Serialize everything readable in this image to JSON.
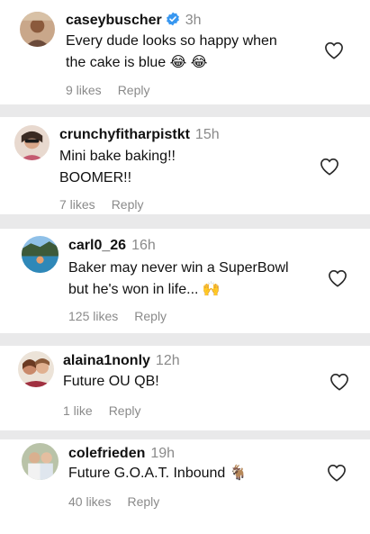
{
  "comments": [
    {
      "username": "caseybuscher",
      "time": "3h",
      "verified": true,
      "text_lines": [
        "Every dude looks so happy when",
        "the cake is blue 😂 😂"
      ],
      "likes": "9 likes",
      "reply": "Reply"
    },
    {
      "username": "crunchyfitharpistkt",
      "time": "15h",
      "text_lines": [
        "Mini bake baking!!",
        "BOOMER!!"
      ],
      "likes": "7 likes",
      "reply": "Reply"
    },
    {
      "username": "carl0_26",
      "time": "16h",
      "text_lines": [
        "Baker may never win a SuperBowl",
        "but he's won in life... 🙌"
      ],
      "likes": "125 likes",
      "reply": "Reply"
    },
    {
      "username": "alaina1nonly",
      "time": "12h",
      "text_lines": [
        "Future OU QB!"
      ],
      "likes": "1 like",
      "reply": "Reply"
    },
    {
      "username": "colefrieden",
      "time": "19h",
      "text_lines": [
        "Future G.O.A.T. Inbound 🐐"
      ],
      "likes": "40 likes",
      "reply": "Reply"
    }
  ],
  "colors": {
    "verified": "#3897f0",
    "muted": "#8a8a8a",
    "separator": "#e9e9ea"
  },
  "icons": [
    "verified-badge-icon",
    "heart-outline-icon"
  ]
}
